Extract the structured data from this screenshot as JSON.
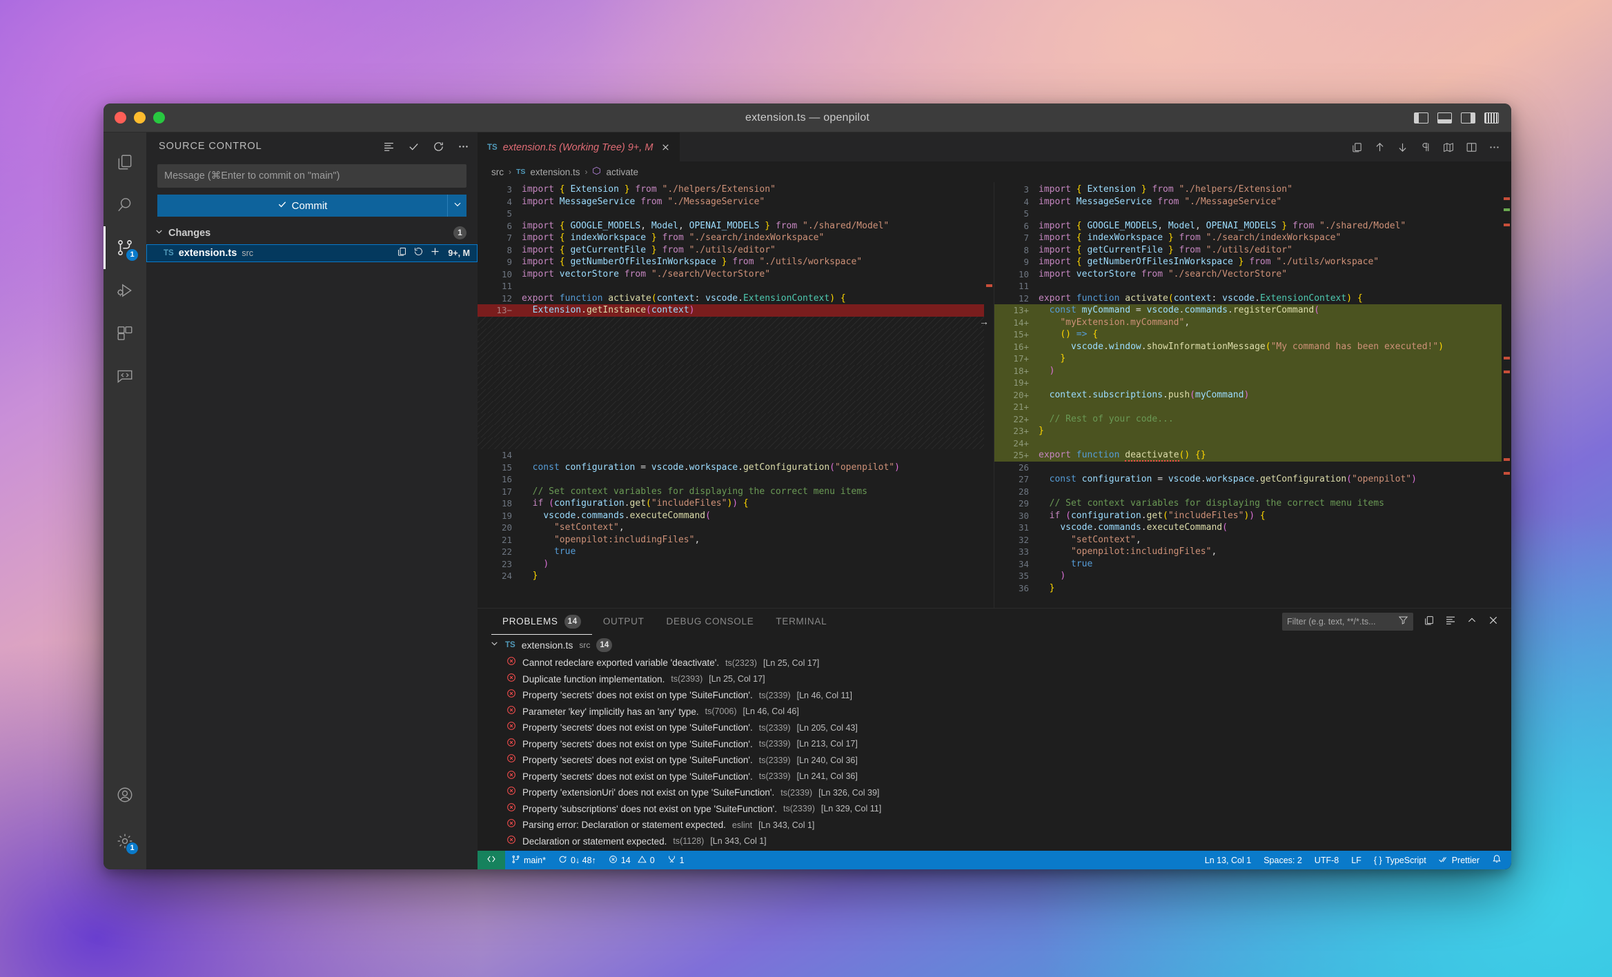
{
  "window": {
    "title": "extension.ts — openpilot",
    "traffic": [
      "close",
      "minimize",
      "zoom"
    ],
    "layout_icons": [
      "toggle-primary-sidebar",
      "toggle-panel",
      "toggle-secondary-sidebar",
      "customize-layout"
    ]
  },
  "activity_bar": {
    "items": [
      {
        "name": "explorer",
        "icon": "files-icon",
        "badge": ""
      },
      {
        "name": "search",
        "icon": "search-icon",
        "badge": ""
      },
      {
        "name": "source-control",
        "icon": "source-control-icon",
        "badge": "1",
        "active": true
      },
      {
        "name": "run-and-debug",
        "icon": "debug-icon",
        "badge": ""
      },
      {
        "name": "extensions",
        "icon": "extensions-icon",
        "badge": ""
      },
      {
        "name": "chat",
        "icon": "code-chat-icon",
        "badge": ""
      }
    ],
    "bottom_items": [
      {
        "name": "accounts",
        "icon": "account-icon",
        "badge": ""
      },
      {
        "name": "settings",
        "icon": "gear-icon",
        "badge": "1"
      }
    ]
  },
  "sidebar": {
    "title": "SOURCE CONTROL",
    "actions": [
      "view-as-list-icon",
      "commit-check-icon",
      "refresh-icon",
      "more-actions-icon"
    ],
    "message_placeholder": "Message (⌘Enter to commit on \"main\")",
    "message_value": "",
    "commit_label": "Commit",
    "commit_dropdown_icon": "chevron-down-icon",
    "changes": {
      "label": "Changes",
      "count": "1",
      "items": [
        {
          "badge": "TS",
          "name": "extension.ts",
          "dir": "src",
          "actions": [
            "open-file-icon",
            "discard-changes-icon",
            "stage-changes-icon"
          ],
          "status": "9+, M"
        }
      ]
    }
  },
  "editor": {
    "tab": {
      "badge": "TS",
      "label": "extension.ts (Working Tree) 9+, M",
      "close_icon": "close-icon"
    },
    "tab_actions": [
      "open-changes-icon",
      "previous-change-icon",
      "next-change-icon",
      "toggle-whitespace-icon",
      "toggle-inline-view-icon",
      "split-editor-icon",
      "more-actions-icon"
    ],
    "breadcrumb": [
      {
        "label": "src",
        "icon": ""
      },
      {
        "label": "extension.ts",
        "icon": "ts-icon"
      },
      {
        "label": "activate",
        "icon": "symbol-function-icon"
      }
    ],
    "left": {
      "lines": [
        {
          "num": "3",
          "kind": "ctx",
          "html": "<span class='kw'>import</span> <span class='brc'>{</span> <span class='var'>Extension</span> <span class='brc'>}</span> <span class='kw'>from</span> <span class='str'>\"./helpers/Extension\"</span>"
        },
        {
          "num": "4",
          "kind": "ctx",
          "html": "<span class='kw'>import</span> <span class='var'>MessageService</span> <span class='kw'>from</span> <span class='str'>\"./MessageService\"</span>"
        },
        {
          "num": "5",
          "kind": "ctx",
          "html": ""
        },
        {
          "num": "6",
          "kind": "ctx",
          "html": "<span class='kw'>import</span> <span class='brc'>{</span> <span class='var'>GOOGLE_MODELS</span><span class='plain'>,</span> <span class='var'>Model</span><span class='plain'>,</span> <span class='var'>OPENAI_MODELS</span> <span class='brc'>}</span> <span class='kw'>from</span> <span class='str'>\"./shared/Model\"</span>"
        },
        {
          "num": "7",
          "kind": "ctx",
          "html": "<span class='kw'>import</span> <span class='brc'>{</span> <span class='var'>indexWorkspace</span> <span class='brc'>}</span> <span class='kw'>from</span> <span class='str'>\"./search/indexWorkspace\"</span>"
        },
        {
          "num": "8",
          "kind": "ctx",
          "html": "<span class='kw'>import</span> <span class='brc'>{</span> <span class='var'>getCurrentFile</span> <span class='brc'>}</span> <span class='kw'>from</span> <span class='str'>\"./utils/editor\"</span>"
        },
        {
          "num": "9",
          "kind": "ctx",
          "html": "<span class='kw'>import</span> <span class='brc'>{</span> <span class='var'>getNumberOfFilesInWorkspace</span> <span class='brc'>}</span> <span class='kw'>from</span> <span class='str'>\"./utils/workspace\"</span>"
        },
        {
          "num": "10",
          "kind": "ctx",
          "html": "<span class='kw'>import</span> <span class='var'>vectorStore</span> <span class='kw'>from</span> <span class='str'>\"./search/VectorStore\"</span>"
        },
        {
          "num": "11",
          "kind": "ctx",
          "html": ""
        },
        {
          "num": "12",
          "kind": "ctx",
          "html": "<span class='kw'>export</span> <span class='kw2'>function</span> <span class='fn'>activate</span><span class='brc'>(</span><span class='var'>context</span><span class='plain'>: </span><span class='var'>vscode</span><span class='plain'>.</span><span class='typ'>ExtensionContext</span><span class='brc'>)</span> <span class='brc'>{</span>"
        },
        {
          "num": "13",
          "kind": "del",
          "html": "  <span class='var'>Extension</span><span class='plain'>.</span><span class='fn'>getInstance</span><span class='brc2'>(</span><span class='var'>context</span><span class='brc2'>)</span>"
        },
        {
          "num": "",
          "kind": "fill",
          "html": ""
        },
        {
          "num": "",
          "kind": "fill",
          "html": ""
        },
        {
          "num": "",
          "kind": "fill",
          "html": ""
        },
        {
          "num": "",
          "kind": "fill",
          "html": ""
        },
        {
          "num": "",
          "kind": "fill",
          "html": ""
        },
        {
          "num": "",
          "kind": "fill",
          "html": ""
        },
        {
          "num": "",
          "kind": "fill",
          "html": ""
        },
        {
          "num": "",
          "kind": "fill",
          "html": ""
        },
        {
          "num": "",
          "kind": "fill",
          "html": ""
        },
        {
          "num": "",
          "kind": "fill",
          "html": ""
        },
        {
          "num": "",
          "kind": "fill",
          "html": ""
        },
        {
          "num": "14",
          "kind": "ctx",
          "html": ""
        },
        {
          "num": "15",
          "kind": "ctx",
          "html": "  <span class='kw2'>const</span> <span class='var'>configuration</span> <span class='op'>=</span> <span class='var'>vscode</span><span class='plain'>.</span><span class='var'>workspace</span><span class='plain'>.</span><span class='fn'>getConfiguration</span><span class='brc2'>(</span><span class='str'>\"openpilot\"</span><span class='brc2'>)</span>"
        },
        {
          "num": "16",
          "kind": "ctx",
          "html": ""
        },
        {
          "num": "17",
          "kind": "ctx",
          "html": "  <span class='cmt'>// Set context variables for displaying the correct menu items</span>"
        },
        {
          "num": "18",
          "kind": "ctx",
          "html": "  <span class='kw'>if</span> <span class='brc2'>(</span><span class='var'>configuration</span><span class='plain'>.</span><span class='fn'>get</span><span class='brc'>(</span><span class='str'>\"includeFiles\"</span><span class='brc'>)</span><span class='brc2'>)</span> <span class='brc'>{</span>"
        },
        {
          "num": "19",
          "kind": "ctx",
          "html": "    <span class='var'>vscode</span><span class='plain'>.</span><span class='var'>commands</span><span class='plain'>.</span><span class='fn'>executeCommand</span><span class='brc2'>(</span>"
        },
        {
          "num": "20",
          "kind": "ctx",
          "html": "      <span class='str'>\"setContext\"</span><span class='plain'>,</span>"
        },
        {
          "num": "21",
          "kind": "ctx",
          "html": "      <span class='str'>\"openpilot:includingFiles\"</span><span class='plain'>,</span>"
        },
        {
          "num": "22",
          "kind": "ctx",
          "html": "      <span class='kw2'>true</span>"
        },
        {
          "num": "23",
          "kind": "ctx",
          "html": "    <span class='brc2'>)</span>"
        },
        {
          "num": "24",
          "kind": "ctx",
          "html": "  <span class='brc'>}</span>"
        }
      ]
    },
    "right": {
      "lines": [
        {
          "num": "3",
          "kind": "ctx",
          "html": "<span class='kw'>import</span> <span class='brc'>{</span> <span class='var'>Extension</span> <span class='brc'>}</span> <span class='kw'>from</span> <span class='str'>\"./helpers/Extension\"</span>"
        },
        {
          "num": "4",
          "kind": "ctx",
          "html": "<span class='kw'>import</span> <span class='var'>MessageService</span> <span class='kw'>from</span> <span class='str'>\"./MessageService\"</span>"
        },
        {
          "num": "5",
          "kind": "ctx",
          "html": ""
        },
        {
          "num": "6",
          "kind": "ctx",
          "html": "<span class='kw'>import</span> <span class='brc'>{</span> <span class='var'>GOOGLE_MODELS</span><span class='plain'>,</span> <span class='var'>Model</span><span class='plain'>,</span> <span class='var'>OPENAI_MODELS</span> <span class='brc'>}</span> <span class='kw'>from</span> <span class='str'>\"./shared/Model\"</span>"
        },
        {
          "num": "7",
          "kind": "ctx",
          "html": "<span class='kw'>import</span> <span class='brc'>{</span> <span class='var'>indexWorkspace</span> <span class='brc'>}</span> <span class='kw'>from</span> <span class='str'>\"./search/indexWorkspace\"</span>"
        },
        {
          "num": "8",
          "kind": "ctx",
          "html": "<span class='kw'>import</span> <span class='brc'>{</span> <span class='var'>getCurrentFile</span> <span class='brc'>}</span> <span class='kw'>from</span> <span class='str'>\"./utils/editor\"</span>"
        },
        {
          "num": "9",
          "kind": "ctx",
          "html": "<span class='kw'>import</span> <span class='brc'>{</span> <span class='var'>getNumberOfFilesInWorkspace</span> <span class='brc'>}</span> <span class='kw'>from</span> <span class='str'>\"./utils/workspace\"</span>"
        },
        {
          "num": "10",
          "kind": "ctx",
          "html": "<span class='kw'>import</span> <span class='var'>vectorStore</span> <span class='kw'>from</span> <span class='str'>\"./search/VectorStore\"</span>"
        },
        {
          "num": "11",
          "kind": "ctx",
          "html": ""
        },
        {
          "num": "12",
          "kind": "ctx",
          "html": "<span class='kw'>export</span> <span class='kw2'>function</span> <span class='fn'>activate</span><span class='brc'>(</span><span class='var'>context</span><span class='plain'>: </span><span class='var'>vscode</span><span class='plain'>.</span><span class='typ'>ExtensionContext</span><span class='brc'>)</span> <span class='brc'>{</span>"
        },
        {
          "num": "13",
          "kind": "add",
          "html": "  <span class='kw2'>const</span> <span class='var'>myCommand</span> <span class='op'>=</span> <span class='var'>vscode</span><span class='plain'>.</span><span class='var'>commands</span><span class='plain'>.</span><span class='fn'>registerCommand</span><span class='brc2'>(</span>"
        },
        {
          "num": "14",
          "kind": "add",
          "html": "    <span class='str'>\"myExtension.myCommand\"</span><span class='plain'>,</span>"
        },
        {
          "num": "15",
          "kind": "add",
          "html": "    <span class='brc'>(</span><span class='brc'>)</span> <span class='kw2'>=&gt;</span> <span class='brc'>{</span>"
        },
        {
          "num": "16",
          "kind": "add",
          "html": "      <span class='var'>vscode</span><span class='plain'>.</span><span class='var'>window</span><span class='plain'>.</span><span class='fn'>showInformationMessage</span><span class='brc'>(</span><span class='str'>\"My command has been executed!\"</span><span class='brc'>)</span>"
        },
        {
          "num": "17",
          "kind": "add",
          "html": "    <span class='brc'>}</span>"
        },
        {
          "num": "18",
          "kind": "add",
          "html": "  <span class='brc2'>)</span>"
        },
        {
          "num": "19",
          "kind": "add",
          "html": ""
        },
        {
          "num": "20",
          "kind": "add",
          "html": "  <span class='var'>context</span><span class='plain'>.</span><span class='var'>subscriptions</span><span class='plain'>.</span><span class='fn'>push</span><span class='brc2'>(</span><span class='var'>myCommand</span><span class='brc2'>)</span>"
        },
        {
          "num": "21",
          "kind": "add",
          "html": ""
        },
        {
          "num": "22",
          "kind": "add",
          "html": "  <span class='cmt'>// Rest of your code...</span>"
        },
        {
          "num": "23",
          "kind": "add",
          "html": "<span class='brc'>}</span>"
        },
        {
          "num": "24",
          "kind": "add",
          "html": ""
        },
        {
          "num": "25",
          "kind": "add",
          "html": "<span class='kw'>export</span> <span class='kw2'>function</span> <span class='fn squig'>deactivate</span><span class='brc'>(</span><span class='brc'>)</span> <span class='brc'>{</span><span class='brc'>}</span>"
        },
        {
          "num": "26",
          "kind": "ctx",
          "html": ""
        },
        {
          "num": "27",
          "kind": "ctx",
          "html": "  <span class='kw2'>const</span> <span class='var'>configuration</span> <span class='op'>=</span> <span class='var'>vscode</span><span class='plain'>.</span><span class='var'>workspace</span><span class='plain'>.</span><span class='fn'>getConfiguration</span><span class='brc2'>(</span><span class='str'>\"openpilot\"</span><span class='brc2'>)</span>"
        },
        {
          "num": "28",
          "kind": "ctx",
          "html": ""
        },
        {
          "num": "29",
          "kind": "ctx",
          "html": "  <span class='cmt'>// Set context variables for displaying the correct menu items</span>"
        },
        {
          "num": "30",
          "kind": "ctx",
          "html": "  <span class='kw'>if</span> <span class='brc2'>(</span><span class='var'>configuration</span><span class='plain'>.</span><span class='fn'>get</span><span class='brc'>(</span><span class='str'>\"includeFiles\"</span><span class='brc'>)</span><span class='brc2'>)</span> <span class='brc'>{</span>"
        },
        {
          "num": "31",
          "kind": "ctx",
          "html": "    <span class='var'>vscode</span><span class='plain'>.</span><span class='var'>commands</span><span class='plain'>.</span><span class='fn'>executeCommand</span><span class='brc2'>(</span>"
        },
        {
          "num": "32",
          "kind": "ctx",
          "html": "      <span class='str'>\"setContext\"</span><span class='plain'>,</span>"
        },
        {
          "num": "33",
          "kind": "ctx",
          "html": "      <span class='str'>\"openpilot:includingFiles\"</span><span class='plain'>,</span>"
        },
        {
          "num": "34",
          "kind": "ctx",
          "html": "      <span class='kw2'>true</span>"
        },
        {
          "num": "35",
          "kind": "ctx",
          "html": "    <span class='brc2'>)</span>"
        },
        {
          "num": "36",
          "kind": "ctx",
          "html": "  <span class='brc'>}</span>"
        }
      ]
    }
  },
  "panel": {
    "tabs": [
      {
        "label": "PROBLEMS",
        "count": "14",
        "active": true
      },
      {
        "label": "OUTPUT",
        "count": "",
        "active": false
      },
      {
        "label": "DEBUG CONSOLE",
        "count": "",
        "active": false
      },
      {
        "label": "TERMINAL",
        "count": "",
        "active": false
      }
    ],
    "filter_placeholder": "Filter (e.g. text, **/*.ts...",
    "filter_value": "",
    "actions": [
      "filter-icon",
      "split-panel-icon",
      "view-as-table-icon",
      "collapse-panel-icon",
      "close-panel-icon"
    ],
    "file_group": {
      "badge": "TS",
      "name": "extension.ts",
      "dir": "src",
      "count": "14",
      "chevron": "chevron-down-icon"
    },
    "problems": [
      {
        "message": "Cannot redeclare exported variable 'deactivate'.",
        "source": "ts(2323)",
        "location": "[Ln 25, Col 17]"
      },
      {
        "message": "Duplicate function implementation.",
        "source": "ts(2393)",
        "location": "[Ln 25, Col 17]"
      },
      {
        "message": "Property 'secrets' does not exist on type 'SuiteFunction'.",
        "source": "ts(2339)",
        "location": "[Ln 46, Col 11]"
      },
      {
        "message": "Parameter 'key' implicitly has an 'any' type.",
        "source": "ts(7006)",
        "location": "[Ln 46, Col 46]"
      },
      {
        "message": "Property 'secrets' does not exist on type 'SuiteFunction'.",
        "source": "ts(2339)",
        "location": "[Ln 205, Col 43]"
      },
      {
        "message": "Property 'secrets' does not exist on type 'SuiteFunction'.",
        "source": "ts(2339)",
        "location": "[Ln 213, Col 17]"
      },
      {
        "message": "Property 'secrets' does not exist on type 'SuiteFunction'.",
        "source": "ts(2339)",
        "location": "[Ln 240, Col 36]"
      },
      {
        "message": "Property 'secrets' does not exist on type 'SuiteFunction'.",
        "source": "ts(2339)",
        "location": "[Ln 241, Col 36]"
      },
      {
        "message": "Property 'extensionUri' does not exist on type 'SuiteFunction'.",
        "source": "ts(2339)",
        "location": "[Ln 326, Col 39]"
      },
      {
        "message": "Property 'subscriptions' does not exist on type 'SuiteFunction'.",
        "source": "ts(2339)",
        "location": "[Ln 329, Col 11]"
      },
      {
        "message": "Parsing error: Declaration or statement expected.",
        "source": "eslint",
        "location": "[Ln 343, Col 1]"
      },
      {
        "message": "Declaration or statement expected.",
        "source": "ts(1128)",
        "location": "[Ln 343, Col 1]"
      }
    ]
  },
  "status_bar": {
    "remote_icon": "remote-window-icon",
    "branch": "main*",
    "sync": "0↓ 48↑",
    "errors": "14",
    "warnings": "0",
    "ports": "1",
    "cursor": "Ln 13, Col 1",
    "indentation": "Spaces: 2",
    "encoding": "UTF-8",
    "eol": "LF",
    "language": "TypeScript",
    "formatter": "Prettier",
    "bell_icon": "notifications-icon"
  },
  "colors": {
    "accent": "#0a7aca",
    "commit_button": "#0e639c",
    "error": "#f14c4c",
    "added": "#4b5320",
    "removed": "#7a1d1d",
    "remote_green": "#16825d"
  }
}
